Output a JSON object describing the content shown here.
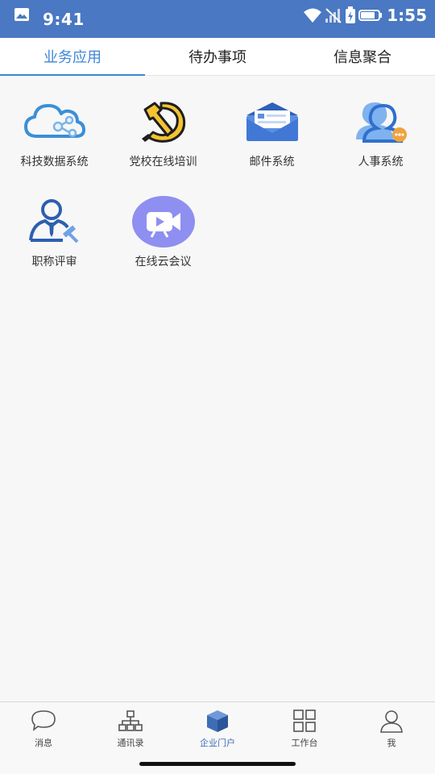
{
  "status_bar": {
    "time_left": "9:41",
    "time_right": "1:55"
  },
  "tabs": [
    {
      "label": "业务应用",
      "active": true
    },
    {
      "label": "待办事项",
      "active": false
    },
    {
      "label": "信息聚合",
      "active": false
    }
  ],
  "apps": [
    {
      "label": "科技数据系统",
      "icon": "cloud-network-icon"
    },
    {
      "label": "党校在线培训",
      "icon": "hammer-sickle-icon"
    },
    {
      "label": "邮件系统",
      "icon": "envelope-icon"
    },
    {
      "label": "人事系统",
      "icon": "person-chat-icon"
    },
    {
      "label": "职称评审",
      "icon": "judge-gavel-icon"
    },
    {
      "label": "在线云会议",
      "icon": "video-camera-icon"
    }
  ],
  "bottom_nav": [
    {
      "label": "消息",
      "icon": "chat-bubble-icon"
    },
    {
      "label": "通讯录",
      "icon": "org-chart-icon"
    },
    {
      "label": "企业门户",
      "icon": "cube-icon",
      "active": true
    },
    {
      "label": "工作台",
      "icon": "grid-icon"
    },
    {
      "label": "我",
      "icon": "user-icon"
    }
  ],
  "colors": {
    "status_bar": "#4a78c2",
    "tab_active": "#3d86d6"
  }
}
